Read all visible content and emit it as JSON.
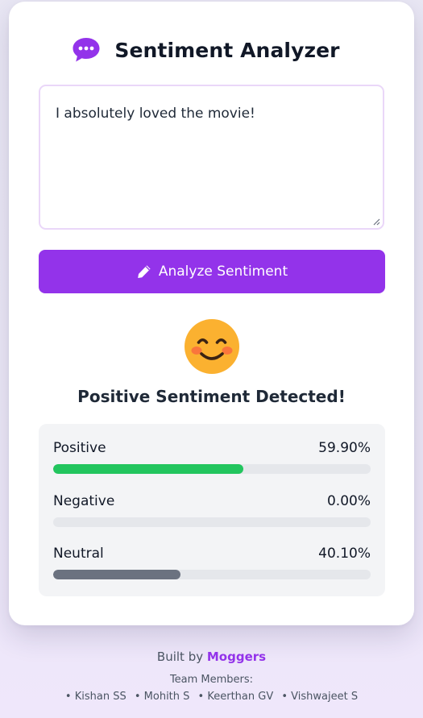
{
  "app": {
    "title": "Sentiment Analyzer",
    "title_icon": "chat-bubble-icon"
  },
  "input": {
    "value": "I absolutely loved the movie!"
  },
  "analyze_button": {
    "label": "Analyze Sentiment",
    "icon": "pencil-icon"
  },
  "result": {
    "emoji": "smiling-face-icon",
    "title": "Positive Sentiment Detected!",
    "scores": [
      {
        "label": "Positive",
        "value": "59.90%",
        "fraction": 0.599,
        "color": "#22c55e"
      },
      {
        "label": "Negative",
        "value": "0.00%",
        "fraction": 0.0,
        "color": "#ef4444"
      },
      {
        "label": "Neutral",
        "value": "40.10%",
        "fraction": 0.401,
        "color": "#6b7280"
      }
    ]
  },
  "footer": {
    "built_by_prefix": "Built by",
    "team_name": "Moggers",
    "team_heading": "Team Members:",
    "members": [
      "Kishan SS",
      "Mohith S",
      "Keerthan GV",
      "Vishwajeet S"
    ]
  },
  "colors": {
    "accent": "#9333ea",
    "input_border": "#ead7f9",
    "positive": "#22c55e",
    "neutral": "#6b7280"
  }
}
